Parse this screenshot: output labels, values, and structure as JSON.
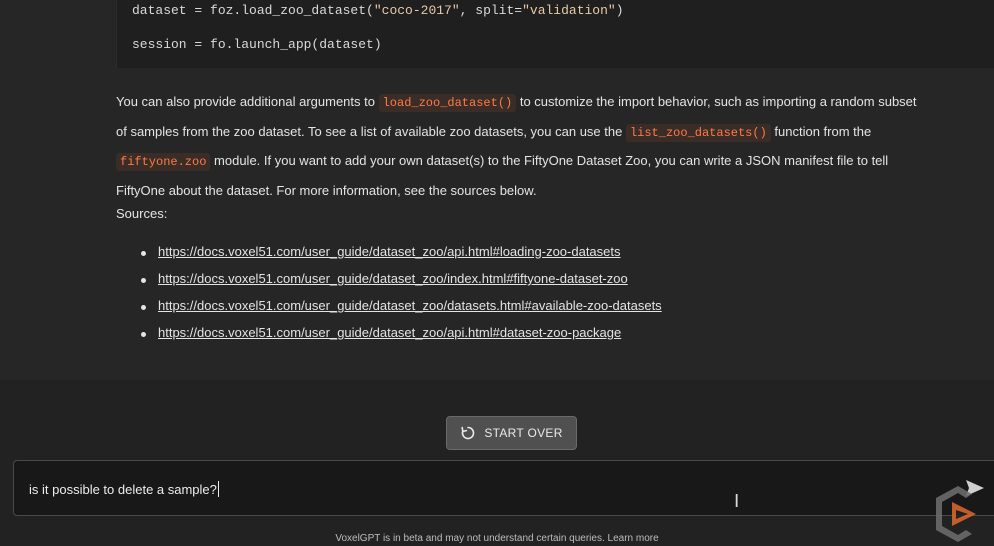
{
  "code": {
    "line1_prefix": "dataset = foz.load_zoo_dataset(",
    "line1_arg1": "\"coco-2017\"",
    "line1_mid": ", split=",
    "line1_arg2": "\"validation\"",
    "line1_suffix": ")",
    "line2": "session = fo.launch_app(dataset)"
  },
  "message": {
    "p1_a": "You can also provide additional arguments to ",
    "p1_code1": "load_zoo_dataset()",
    "p1_b": " to customize the import behavior, such as importing a random subset",
    "p2_a": "of samples from the zoo dataset. To see a list of available zoo datasets, you can use the ",
    "p2_code": "list_zoo_datasets()",
    "p2_b": " function from the",
    "p3_code": "fiftyone.zoo",
    "p3_b": " module. If you want to add your own dataset(s) to the FiftyOne Dataset Zoo, you can write a JSON manifest file to tell",
    "p4": "FiftyOne about the dataset. For more information, see the sources below.",
    "sources_label": "Sources:",
    "sources": [
      "https://docs.voxel51.com/user_guide/dataset_zoo/api.html#loading-zoo-datasets",
      "https://docs.voxel51.com/user_guide/dataset_zoo/index.html#fiftyone-dataset-zoo",
      "https://docs.voxel51.com/user_guide/dataset_zoo/datasets.html#available-zoo-datasets",
      "https://docs.voxel51.com/user_guide/dataset_zoo/api.html#dataset-zoo-package"
    ]
  },
  "start_over": {
    "label": "START OVER",
    "icon": "reset-icon"
  },
  "input": {
    "value": "is it possible to delete a sample?"
  },
  "send": {
    "icon": "send-icon"
  },
  "footer": {
    "text": "VoxelGPT is in beta and may not understand certain queries. Learn more"
  },
  "colors": {
    "accent_code": "#ff7a45",
    "background": "#222222",
    "panel": "#262626"
  }
}
